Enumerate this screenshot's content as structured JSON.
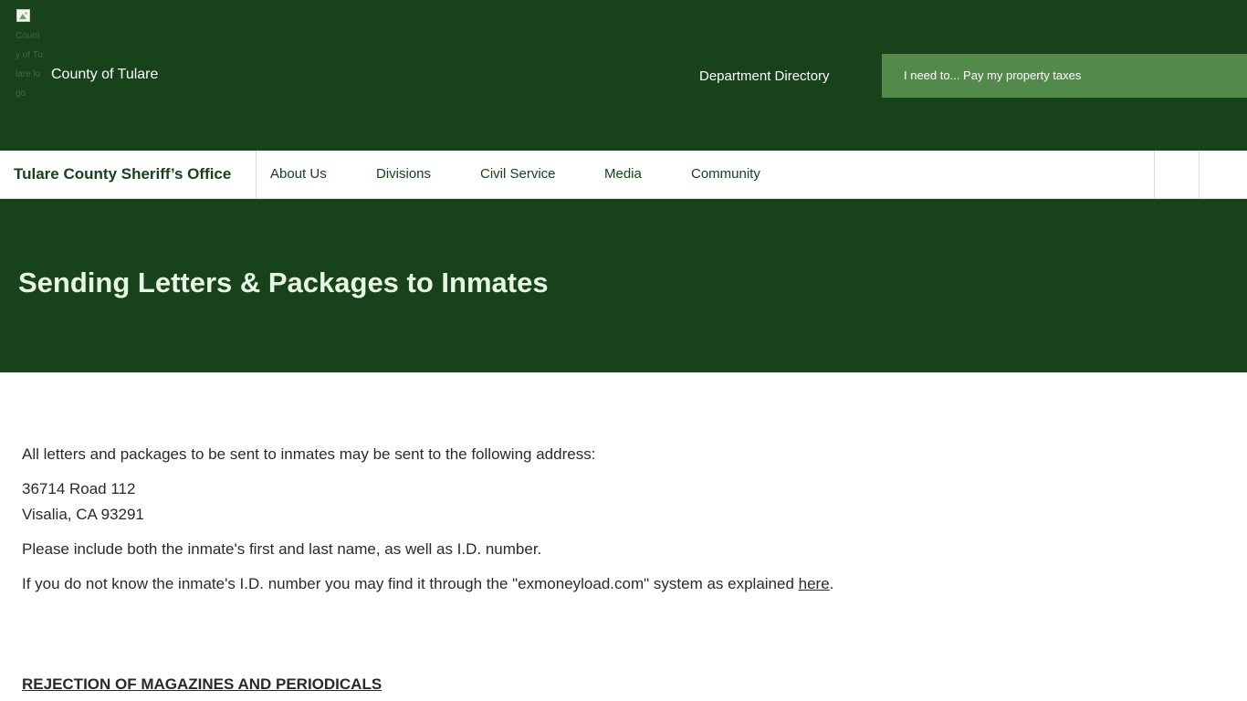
{
  "county_header": {
    "logo_alt": "County of Tulare logo",
    "county_name": "County of Tulare",
    "department_directory": "Department Directory",
    "i_need_to": "I need to... Pay my property taxes"
  },
  "department_nav": {
    "title": "Tulare County Sheriff’s Office",
    "items": [
      {
        "label": "About Us"
      },
      {
        "label": "Divisions"
      },
      {
        "label": "Civil Service"
      },
      {
        "label": "Media"
      },
      {
        "label": "Community"
      }
    ]
  },
  "hero": {
    "title": "Sending Letters & Packages to Inmates"
  },
  "content": {
    "intro": "All letters and packages to be sent to inmates may be sent to the following address:",
    "address_line1": "36714 Road 112",
    "address_line2": "Visalia, CA 93291",
    "name_instructions": "Please include both the inmate's first and last name, as well as I.D. number.",
    "id_lookup_text": "If you do not know the inmate's I.D. number you may find it through the \"exmoneyload.com\" system as explained ",
    "id_lookup_link": "here",
    "id_lookup_end": ".",
    "section_heading": "REJECTION OF MAGAZINES AND PERIODICALS"
  },
  "colors": {
    "header_green": "#17421a",
    "accent_green": "#528a4a",
    "title_text": "#e6f6e2"
  },
  "icons": [
    "broken-image-icon"
  ]
}
